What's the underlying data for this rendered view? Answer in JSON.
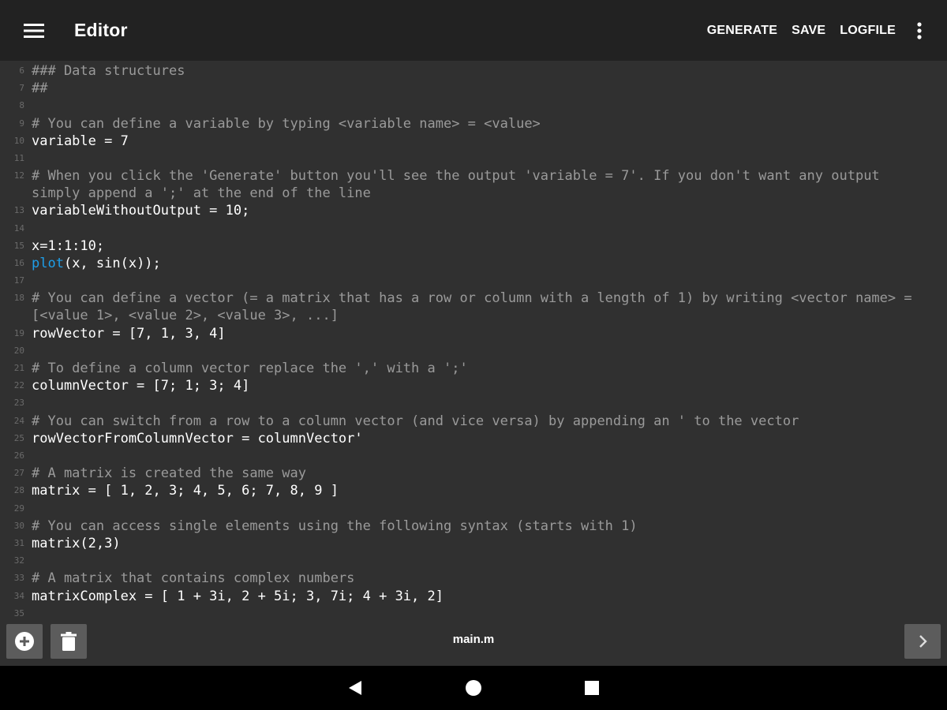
{
  "appbar": {
    "title": "Editor",
    "icons": {
      "menu": "hamburger-menu-icon",
      "overflow": "more-vertical-icon"
    },
    "actions": [
      "GENERATE",
      "SAVE",
      "LOGFILE"
    ]
  },
  "editor": {
    "lines": [
      {
        "n": "6",
        "text": "### Data structures",
        "kind": "comment"
      },
      {
        "n": "7",
        "text": "##",
        "kind": "comment"
      },
      {
        "n": "8",
        "text": "",
        "kind": "code"
      },
      {
        "n": "9",
        "text": "# You can define a variable by typing <variable name> = <value>",
        "kind": "comment"
      },
      {
        "n": "10",
        "text": "variable = 7",
        "kind": "code"
      },
      {
        "n": "11",
        "text": "",
        "kind": "code"
      },
      {
        "n": "12",
        "text": "# When you click the 'Generate' button you'll see the output 'variable = 7'. If you don't want any output simply append a ';' at the end of the line",
        "kind": "comment"
      },
      {
        "n": "13",
        "text": "variableWithoutOutput = 10;",
        "kind": "code"
      },
      {
        "n": "14",
        "text": "",
        "kind": "code"
      },
      {
        "n": "15",
        "text": "x=1:1:10;",
        "kind": "code"
      },
      {
        "n": "16",
        "fn": "plot",
        "rest": "(x, sin(x));",
        "kind": "fncall"
      },
      {
        "n": "17",
        "text": "",
        "kind": "code"
      },
      {
        "n": "18",
        "text": "# You can define a vector (= a matrix that has a row or column with a length of 1) by writing <vector name> = [<value 1>, <value 2>, <value 3>, ...]",
        "kind": "comment"
      },
      {
        "n": "19",
        "text": "rowVector = [7, 1, 3, 4]",
        "kind": "code"
      },
      {
        "n": "20",
        "text": "",
        "kind": "code"
      },
      {
        "n": "21",
        "text": "# To define a column vector replace the ',' with a ';'",
        "kind": "comment"
      },
      {
        "n": "22",
        "text": "columnVector = [7; 1; 3; 4]",
        "kind": "code"
      },
      {
        "n": "23",
        "text": "",
        "kind": "code"
      },
      {
        "n": "24",
        "text": "# You can switch from a row to a column vector (and vice versa) by appending an ' to the vector",
        "kind": "comment"
      },
      {
        "n": "25",
        "text": "rowVectorFromColumnVector = columnVector'",
        "kind": "code"
      },
      {
        "n": "26",
        "text": "",
        "kind": "code"
      },
      {
        "n": "27",
        "text": "# A matrix is created the same way",
        "kind": "comment"
      },
      {
        "n": "28",
        "text": "matrix = [ 1, 2, 3; 4, 5, 6; 7, 8, 9 ]",
        "kind": "code"
      },
      {
        "n": "29",
        "text": "",
        "kind": "code"
      },
      {
        "n": "30",
        "text": "# You can access single elements using the following syntax (starts with 1)",
        "kind": "comment"
      },
      {
        "n": "31",
        "text": "matrix(2,3)",
        "kind": "code"
      },
      {
        "n": "32",
        "text": "",
        "kind": "code"
      },
      {
        "n": "33",
        "text": "# A matrix that contains complex numbers",
        "kind": "comment"
      },
      {
        "n": "34",
        "text": "matrixComplex = [ 1 + 3i, 2 + 5i; 3, 7i; 4 + 3i, 2]",
        "kind": "code"
      },
      {
        "n": "35",
        "text": "",
        "kind": "code"
      }
    ]
  },
  "bottombar": {
    "filename": "main.m",
    "icons": {
      "add": "add-circle-icon",
      "delete": "trash-icon",
      "next": "chevron-right-icon"
    }
  },
  "navbar": {
    "icons": {
      "back": "back-triangle-icon",
      "home": "home-circle-icon",
      "recents": "recents-square-icon"
    }
  },
  "colors": {
    "appbar_bg": "#222222",
    "editor_bg": "#303030",
    "comment": "#9a9a9a",
    "code": "#ffffff",
    "function_highlight": "#1e9ee8",
    "line_number": "#6a6a6a",
    "button_bg": "#5c5c5c",
    "navbar_bg": "#000000"
  }
}
